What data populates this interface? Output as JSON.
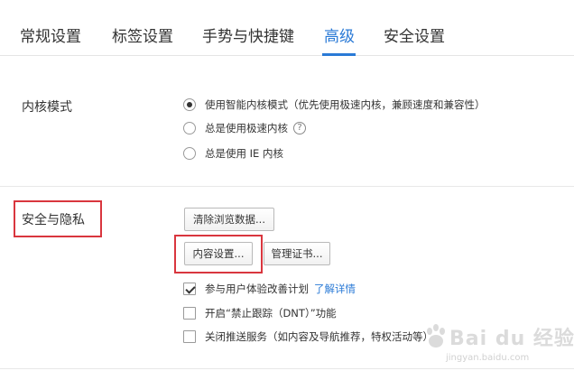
{
  "tabs": [
    {
      "label": "常规设置",
      "active": false
    },
    {
      "label": "标签设置",
      "active": false
    },
    {
      "label": "手势与快捷键",
      "active": false
    },
    {
      "label": "高级",
      "active": true
    },
    {
      "label": "安全设置",
      "active": false
    }
  ],
  "kernel": {
    "label": "内核模式",
    "options": [
      {
        "label": "使用智能内核模式（优先使用极速内核，兼顾速度和兼容性）",
        "checked": true
      },
      {
        "label": "总是使用极速内核",
        "checked": false,
        "help": "?"
      },
      {
        "label": "总是使用 IE 内核",
        "checked": false
      }
    ]
  },
  "privacy": {
    "label": "安全与隐私",
    "clear_data_button": "清除浏览数据...",
    "content_settings_button": "内容设置...",
    "manage_cert_button": "管理证书...",
    "options": [
      {
        "label": "参与用户体验改善计划",
        "checked": true,
        "link": "了解详情"
      },
      {
        "label": "开启“禁止跟踪（DNT）”功能",
        "checked": false
      },
      {
        "label": "关闭推送服务（如内容及导航推荐，特权活动等）",
        "checked": false
      }
    ]
  },
  "watermark": {
    "main": "Bai du 经验",
    "sub": "jingyan.baidu.com"
  },
  "colors": {
    "accent": "#2a7ad6",
    "annotation": "#d9363e"
  }
}
